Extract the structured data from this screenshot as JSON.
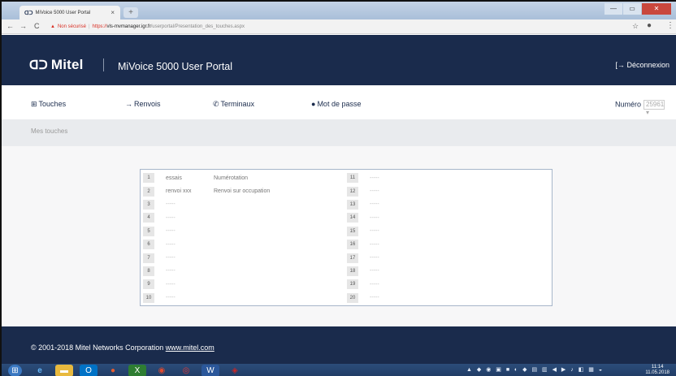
{
  "browser": {
    "tab_title": "MiVoice 5000 User Portal",
    "tab_close": "×",
    "new_tab": "+",
    "address": {
      "warning": "▲",
      "security_label": "Non sécurisé",
      "https": "https://",
      "host": "vls-mvmanager.igr.fr",
      "path": "/userportal/Presentation_des_touches.aspx"
    }
  },
  "header": {
    "logo": "Mitel",
    "logo_mark": "ᗡᑐ",
    "title": "MiVoice 5000 User Portal",
    "logout": "Déconnexion"
  },
  "nav": {
    "items": [
      {
        "icon": "⊞",
        "label": "Touches"
      },
      {
        "icon": "→",
        "label": "Renvois"
      },
      {
        "icon": "✆",
        "label": "Terminaux"
      },
      {
        "icon": "●",
        "label": "Mot de passe"
      }
    ],
    "numero_label": "Numéro",
    "numero_value": "25961 ▾"
  },
  "section": {
    "title": "Mes touches"
  },
  "keys": {
    "left": [
      {
        "n": "1",
        "label": "essais",
        "func": "Numérotation"
      },
      {
        "n": "2",
        "label": "renvoi xxx",
        "func": "Renvoi sur occupation"
      },
      {
        "n": "3",
        "label": "-----",
        "func": ""
      },
      {
        "n": "4",
        "label": "-----",
        "func": ""
      },
      {
        "n": "5",
        "label": "-----",
        "func": ""
      },
      {
        "n": "6",
        "label": "-----",
        "func": ""
      },
      {
        "n": "7",
        "label": "-----",
        "func": ""
      },
      {
        "n": "8",
        "label": "-----",
        "func": ""
      },
      {
        "n": "9",
        "label": "-----",
        "func": ""
      },
      {
        "n": "10",
        "label": "-----",
        "func": ""
      }
    ],
    "right": [
      {
        "n": "11",
        "label": "-----"
      },
      {
        "n": "12",
        "label": "-----"
      },
      {
        "n": "13",
        "label": "-----"
      },
      {
        "n": "14",
        "label": "-----"
      },
      {
        "n": "15",
        "label": "-----"
      },
      {
        "n": "16",
        "label": "-----"
      },
      {
        "n": "17",
        "label": "-----"
      },
      {
        "n": "18",
        "label": "-----"
      },
      {
        "n": "19",
        "label": "-----"
      },
      {
        "n": "20",
        "label": "-----"
      }
    ]
  },
  "footer": {
    "copyright": "© 2001-2018 Mitel Networks Corporation",
    "link": "www.mitel.com"
  },
  "taskbar": {
    "clock_time": "11:14",
    "clock_date": "11.05.2018"
  },
  "colors": {
    "brand_navy": "#1a2b4c",
    "warning_red": "#d93025"
  }
}
